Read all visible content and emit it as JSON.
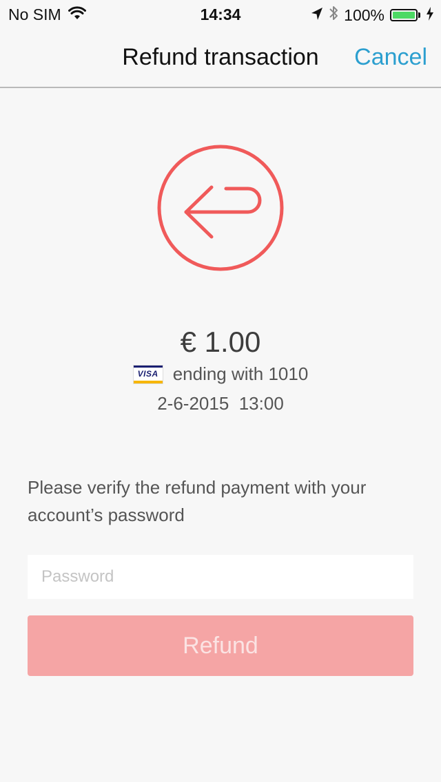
{
  "status_bar": {
    "carrier": "No SIM",
    "time": "14:34",
    "battery": "100%",
    "battery_level": 1.0,
    "icons": [
      "wifi-icon",
      "location-arrow-icon",
      "bluetooth-icon",
      "battery-icon",
      "charging-bolt-icon"
    ]
  },
  "nav": {
    "title": "Refund transaction",
    "cancel_label": "Cancel"
  },
  "transaction": {
    "icon": "refund-arrow-icon",
    "amount": "€ 1.00",
    "card_brand": "VISA",
    "card_text": "ending with 1010",
    "datetime": "2-6-2015  13:00"
  },
  "verify": {
    "message": "Please verify the refund payment with your account’s password",
    "password_placeholder": "Password",
    "password_value": "",
    "refund_label": "Refund"
  },
  "colors": {
    "accent": "#2c9fcf",
    "refund_red": "#f05a5a",
    "button_disabled": "#f5a5a5",
    "background": "#f7f7f7"
  }
}
